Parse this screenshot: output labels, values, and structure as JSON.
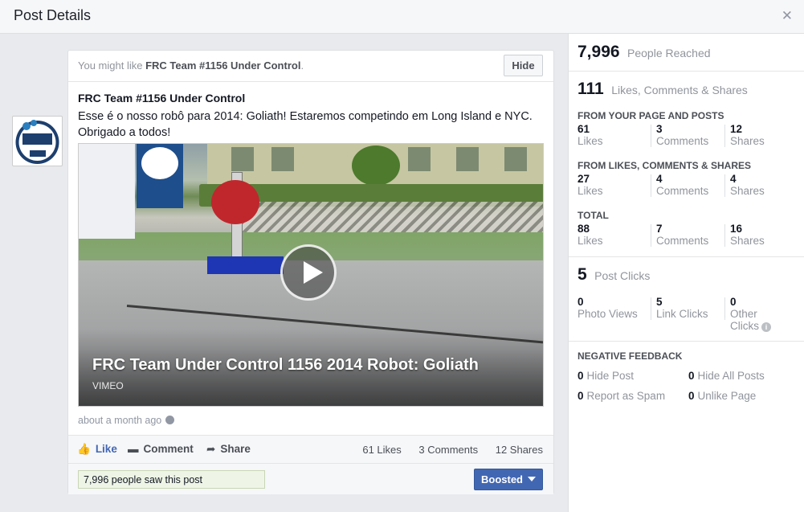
{
  "header": {
    "title": "Post Details",
    "close_icon": "close-icon"
  },
  "suggest": {
    "prefix": "You might like ",
    "page": "FRC Team #1156 Under Control",
    "suffix": ".",
    "hide_label": "Hide"
  },
  "post": {
    "author": "FRC Team #1156 Under Control",
    "text": "Esse é o nosso robô para 2014: Goliath! Estaremos competindo em Long Island e NYC. Obrigado a todos!",
    "video_title": "FRC Team Under Control 1156 2014 Robot: Goliath",
    "video_source": "VIMEO",
    "timestamp": "about a month ago"
  },
  "actions": {
    "like": "Like",
    "comment": "Comment",
    "share": "Share",
    "likes_count": "61 Likes",
    "comments_count": "3 Comments",
    "shares_count": "12 Shares"
  },
  "footer": {
    "saw": "7,996 people saw this post",
    "boosted": "Boosted"
  },
  "insights": {
    "reached": {
      "num": "7,996",
      "label": "People Reached"
    },
    "engagement": {
      "num": "111",
      "label": "Likes, Comments & Shares"
    },
    "from_page": {
      "title": "FROM YOUR PAGE AND POSTS",
      "likes": "61",
      "comments": "3",
      "shares": "12"
    },
    "from_lcs": {
      "title": "FROM LIKES, COMMENTS & SHARES",
      "likes": "27",
      "comments": "4",
      "shares": "4"
    },
    "total": {
      "title": "TOTAL",
      "likes": "88",
      "comments": "7",
      "shares": "16"
    },
    "labels": {
      "likes": "Likes",
      "comments": "Comments",
      "shares": "Shares"
    },
    "clicks": {
      "num": "5",
      "label": "Post Clicks",
      "photo_views": "0",
      "photo_views_label": "Photo Views",
      "link_clicks": "5",
      "link_clicks_label": "Link Clicks",
      "other_clicks": "0",
      "other_clicks_label_1": "Other",
      "other_clicks_label_2": "Clicks"
    },
    "negative": {
      "title": "NEGATIVE FEEDBACK",
      "hide_post": "0",
      "hide_post_label": "Hide Post",
      "hide_all": "0",
      "hide_all_label": "Hide All Posts",
      "spam": "0",
      "spam_label": "Report as Spam",
      "unlike": "0",
      "unlike_label": "Unlike Page"
    }
  }
}
